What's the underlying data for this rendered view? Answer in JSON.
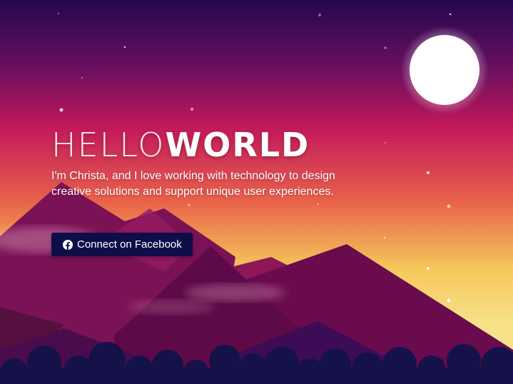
{
  "hero": {
    "title_light": "HELLO",
    "title_bold": "WORLD",
    "subtitle": "I'm Christa, and I love working with technology to design creative solutions and support unique user experiences."
  },
  "cta": {
    "label": "Connect on Facebook",
    "icon": "facebook-icon"
  },
  "colors": {
    "sky_top": "#2a0a5c",
    "sky_mid": "#c2185b",
    "sky_low": "#f5c85a",
    "button_bg": "#0d0d48",
    "mountain": "#6b0a4e",
    "foreground": "#12124a"
  }
}
